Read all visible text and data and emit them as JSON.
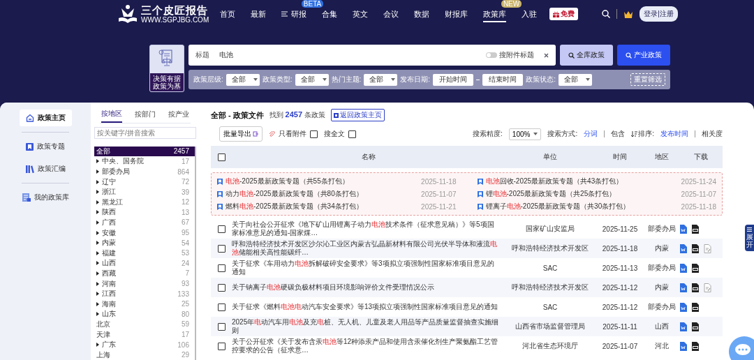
{
  "logo": {
    "name": "三个皮匠报告",
    "url": "WWW.SGPJBG.COM"
  },
  "nav": {
    "items": [
      {
        "label": "首页",
        "selected": false,
        "kind": "plain"
      },
      {
        "label": "最新",
        "selected": false,
        "kind": "plain"
      },
      {
        "label": "研报",
        "selected": false,
        "kind": "menu",
        "badge": "BETA"
      },
      {
        "label": "合集",
        "selected": false,
        "kind": "plain"
      },
      {
        "label": "英文",
        "selected": false,
        "kind": "plain"
      },
      {
        "label": "会议",
        "selected": false,
        "kind": "plain"
      },
      {
        "label": "数据",
        "selected": false,
        "kind": "plain"
      },
      {
        "label": "财报库",
        "selected": false,
        "kind": "plain"
      },
      {
        "label": "政策库",
        "selected": true,
        "kind": "plain",
        "badge": "NEW"
      },
      {
        "label": "入驻",
        "selected": false,
        "kind": "plain"
      }
    ],
    "free_button": "免费",
    "login": "登录|注册"
  },
  "badge": {
    "lines": [
      "决策有据",
      "政策为基"
    ]
  },
  "search": {
    "scope": "标题",
    "value": "电池",
    "toggle": {
      "label": "搜附件标题",
      "on": false
    },
    "buttons": [
      {
        "label": "全库政策",
        "kind": "light"
      },
      {
        "label": "产业政策",
        "kind": "primary"
      }
    ]
  },
  "filters": {
    "selects": [
      {
        "label": "政策层级:",
        "value": "全部"
      },
      {
        "label": "政策类型:",
        "value": "全部"
      },
      {
        "label": "热门主题:",
        "value": "全部"
      }
    ],
    "date_label": "发布日期:",
    "start": "开始时间",
    "end": "结束时间",
    "status": {
      "label": "政策状态:",
      "value": "全部"
    },
    "reset": "重置筛选"
  },
  "left_nav": [
    {
      "label": "政策主页",
      "selected": true,
      "kind": "home"
    },
    {
      "label": "政策专题",
      "selected": false,
      "kind": "topic"
    },
    {
      "label": "政策汇编",
      "selected": false,
      "kind": "books"
    },
    {
      "label": "我的政策库",
      "selected": false,
      "kind": "mine"
    }
  ],
  "tree_tabs": [
    {
      "label": "按地区",
      "selected": true
    },
    {
      "label": "按部门",
      "selected": false
    },
    {
      "label": "按产业",
      "selected": false
    }
  ],
  "tree_search": {
    "placeholder": "按关键字/拼音搜索"
  },
  "tree": [
    {
      "name": "全部",
      "count": "2457",
      "selected": true,
      "kind": "leaf"
    },
    {
      "name": "中央、国务院",
      "count": "17",
      "selected": false,
      "kind": "branch"
    },
    {
      "name": "部委办局",
      "count": "864",
      "selected": false,
      "kind": "branch"
    },
    {
      "name": "辽宁",
      "count": "72",
      "selected": false,
      "kind": "branch"
    },
    {
      "name": "浙江",
      "count": "39",
      "selected": false,
      "kind": "branch"
    },
    {
      "name": "黑龙江",
      "count": "12",
      "selected": false,
      "kind": "branch"
    },
    {
      "name": "陕西",
      "count": "13",
      "selected": false,
      "kind": "branch"
    },
    {
      "name": "广西",
      "count": "67",
      "selected": false,
      "kind": "branch"
    },
    {
      "name": "安徽",
      "count": "95",
      "selected": false,
      "kind": "branch"
    },
    {
      "name": "内蒙",
      "count": "54",
      "selected": false,
      "kind": "branch"
    },
    {
      "name": "福建",
      "count": "53",
      "selected": false,
      "kind": "branch"
    },
    {
      "name": "山西",
      "count": "24",
      "selected": false,
      "kind": "branch"
    },
    {
      "name": "西藏",
      "count": "7",
      "selected": false,
      "kind": "branch"
    },
    {
      "name": "河南",
      "count": "93",
      "selected": false,
      "kind": "branch"
    },
    {
      "name": "江西",
      "count": "133",
      "selected": false,
      "kind": "branch"
    },
    {
      "name": "海南",
      "count": "25",
      "selected": false,
      "kind": "branch"
    },
    {
      "name": "山东",
      "count": "80",
      "selected": false,
      "kind": "branch"
    },
    {
      "name": "北京",
      "count": "59",
      "selected": false,
      "kind": "leaf"
    },
    {
      "name": "天津",
      "count": "17",
      "selected": false,
      "kind": "leaf"
    },
    {
      "name": "广东",
      "count": "106",
      "selected": false,
      "kind": "branch"
    },
    {
      "name": "上海",
      "count": "29",
      "selected": false,
      "kind": "leaf"
    }
  ],
  "main": {
    "title": "全部 - 政策文件",
    "found": "找到 **2457** 条政策",
    "back_button": "返回政策主页"
  },
  "toolbar": {
    "export": "批量导出",
    "attach_only": {
      "label": "只看附件",
      "checked": false
    },
    "full_text": {
      "label": "搜全文",
      "checked": false
    },
    "precision_label": "搜索精度:",
    "precision": "100%",
    "mode_label": "搜索方式:",
    "modes": [
      {
        "label": "分词",
        "selected": true
      },
      {
        "label": "包含",
        "selected": false
      }
    ],
    "sort_label": "排序:",
    "sorts": [
      {
        "label": "发布时间",
        "selected": true
      },
      {
        "label": "相关度",
        "selected": false
      }
    ]
  },
  "table": {
    "columns": [
      "名称",
      "单位",
      "时间",
      "地区",
      "下载"
    ],
    "all_checked": false
  },
  "topics": [
    {
      "title": "**电池**-2025最新政策专题（共55条打包）",
      "date": "2025-11-18"
    },
    {
      "title": "**电池**回收-2025最新政策专题（共43条打包）",
      "date": "2025-11-24"
    },
    {
      "title": "动力**电池**-2025最新政策专题（共80条打包）",
      "date": "2025-11-07"
    },
    {
      "title": "锂**电池**-2025最新政策专题（共25条打包）",
      "date": "2025-11-07"
    },
    {
      "title": "燃料**电池**-2025最新政策专题（共34条打包）",
      "date": "2025-11-21"
    },
    {
      "title": "锂离子**电池**-2025最新政策专题（共30条打包）",
      "date": "2025-11-18"
    }
  ],
  "rows": [
    {
      "title": "关于向社会公开征求《地下矿山用锂离子动力**电池**技术条件（征求意见稿）》等5项国家标准意见的通知-国家煤…",
      "unit": "国家矿山安监局",
      "date": "2025-11-25",
      "region": "部委办局",
      "checked": false,
      "files": [
        {
          "kind": "word"
        },
        {
          "kind": "pdf"
        }
      ]
    },
    {
      "title": "呼和浩特经济技术开发区沙尔沁工业区内蒙古弘晶新材料有限公司光伏半导体和液流**电池**储能相关高性能碳纤…",
      "unit": "呼和浩特经济技术开发区",
      "date": "2025-11-18",
      "region": "内蒙",
      "checked": false,
      "files": [
        {
          "kind": "word"
        },
        {
          "kind": "pdf"
        },
        {
          "kind": "note"
        }
      ]
    },
    {
      "title": "关于征求《车用动力**电池**拆解破碎安全要求》等3项拟立项强制性国家标准项目意见的通知",
      "unit": "SAC",
      "date": "2025-11-13",
      "region": "部委办局",
      "checked": false,
      "files": [
        {
          "kind": "word"
        },
        {
          "kind": "pdf"
        }
      ]
    },
    {
      "title": "关于钠离子**电池**硬碳负极材料项目环境影响评价文件受理情况公示",
      "unit": "呼和浩特经济技术开发区",
      "date": "2025-11-12",
      "region": "内蒙",
      "checked": false,
      "files": [
        {
          "kind": "word"
        },
        {
          "kind": "pdf"
        },
        {
          "kind": "note"
        }
      ]
    },
    {
      "title": "关于征求《燃料**电池电**动汽车安全要求》等13项拟立项强制性国家标准项目意见的通知",
      "unit": "SAC",
      "date": "2025-11-12",
      "region": "部委办局",
      "checked": false,
      "files": [
        {
          "kind": "word"
        },
        {
          "kind": "pdf"
        }
      ]
    },
    {
      "title": "2025年**电**动汽车用**电池**及充**电**桩、无人机、儿童及老人用品等产品质量监督抽查实施细则",
      "unit": "山西省市场监督管理局",
      "date": "2025-11-11",
      "region": "山西",
      "checked": false,
      "files": [
        {
          "kind": "word"
        },
        {
          "kind": "pdf"
        }
      ]
    },
    {
      "title": "关于公开征求《关于发布含汞**电池**等12种添汞产品和使用含汞催化剂生产聚氨酯工艺管控要求的公告（征求意…",
      "unit": "河北省生态环境厅",
      "date": "2025-11-07",
      "region": "河北",
      "checked": false,
      "files": [
        {
          "kind": "word"
        },
        {
          "kind": "pdf"
        }
      ]
    }
  ],
  "side_tab": {
    "label": "展开"
  }
}
